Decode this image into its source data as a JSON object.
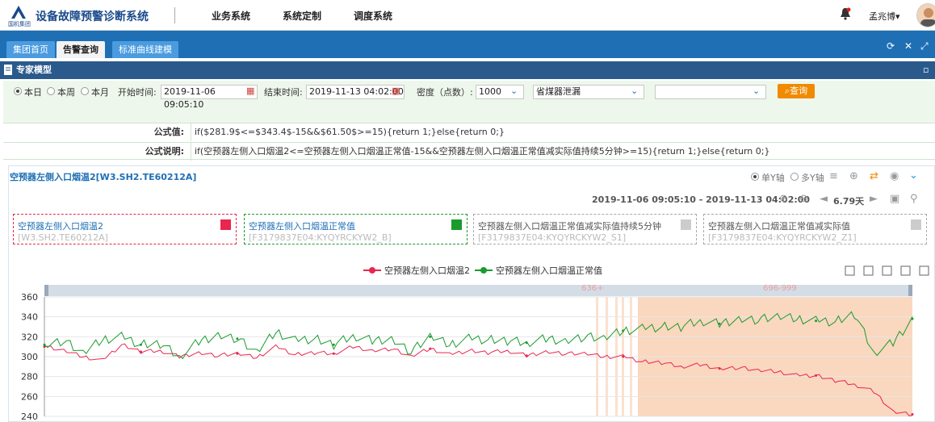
{
  "app": {
    "title": "设备故障预警诊断系统",
    "logo_text": "国机集团",
    "nav": [
      "业务系统",
      "系统定制",
      "调度系统"
    ],
    "user": "孟兆博▾"
  },
  "tabs": [
    {
      "label": "集团首页"
    },
    {
      "label": "告警查询"
    },
    {
      "label": "标准曲线建模"
    }
  ],
  "panel": {
    "title": "专家模型"
  },
  "filter": {
    "period_options": [
      "本日",
      "本周",
      "本月"
    ],
    "start_label": "开始时间:",
    "start_value": "2019-11-06 09:05:10",
    "end_label": "结束时间:",
    "end_value": "2019-11-13 04:02:00",
    "density_label": "密度（点数）:",
    "density_value": "1000",
    "model_value": "省煤器泄漏",
    "extra_value": "",
    "query_label": "查询"
  },
  "formula": {
    "value_label": "公式值:",
    "value": "if($281.9$<=$343.4$-15&&$61.50$>=15){return 1;}else{return 0;}",
    "desc_label": "公式说明:",
    "desc": "if(空预器左侧入口烟温2<=空预器左侧入口烟温正常值-15&&空预器左侧入口烟温正常值减实际值持续5分钟>=15){return 1;}else{return 0;}"
  },
  "chart_card": {
    "title": "空预器左侧入口烟温2[W3.SH2.TE60212A]",
    "axis_mode": [
      "单Y轴",
      "多Y轴"
    ],
    "range": "2019-11-06 09:05:10 - 2019-11-13 04:02:00",
    "span": "6.79天",
    "legend_boxes": [
      {
        "name": "空预器左侧入口烟温2",
        "code": "[W3.SH2.TE60212A]",
        "color": "#e8264f"
      },
      {
        "name": "空预器左侧入口烟温正常值",
        "code": "[F3179837E04:KYQYRCKYW2_B]",
        "color": "#1a9b2e"
      },
      {
        "name": "空预器左侧入口烟温正常值减实际值持续5分钟",
        "code": "[F3179837E04:KYQYRCKYW2_S1]",
        "color": "#cccccc"
      },
      {
        "name": "空预器左侧入口烟温正常值减实际值",
        "code": "[F3179837E04:KYQYRCKYW2_Z1]",
        "color": "#cccccc"
      }
    ]
  },
  "chart_data": {
    "type": "line",
    "yticks": [
      240,
      260,
      280,
      300,
      320,
      340,
      360
    ],
    "ylim": [
      240,
      360
    ],
    "series": [
      {
        "name": "空预器左侧入口烟温2",
        "color": "#e8264f",
        "values": [
          310,
          306,
          300,
          296,
          312,
          305,
          306,
          300,
          304,
          301,
          303,
          299,
          310,
          302,
          304,
          303,
          310,
          306,
          308,
          300,
          308,
          302,
          306,
          304,
          306,
          301,
          305,
          303,
          303,
          300,
          300,
          295,
          294,
          290,
          292,
          288,
          289,
          286,
          285,
          281,
          281,
          276,
          272,
          265,
          245,
          242
        ]
      },
      {
        "name": "空预器左侧入口烟温正常值",
        "color": "#1a9b2e",
        "values": [
          312,
          316,
          303,
          317,
          320,
          312,
          313,
          300,
          315,
          322,
          318,
          304,
          325,
          316,
          318,
          312,
          321,
          316,
          318,
          305,
          320,
          312,
          318,
          317,
          316,
          314,
          318,
          316,
          320,
          318,
          326,
          328,
          330,
          330,
          336,
          333,
          338,
          337,
          340,
          338,
          336,
          335,
          343,
          304,
          314,
          338
        ]
      }
    ],
    "markers": [
      "636+",
      "696-999"
    ]
  }
}
